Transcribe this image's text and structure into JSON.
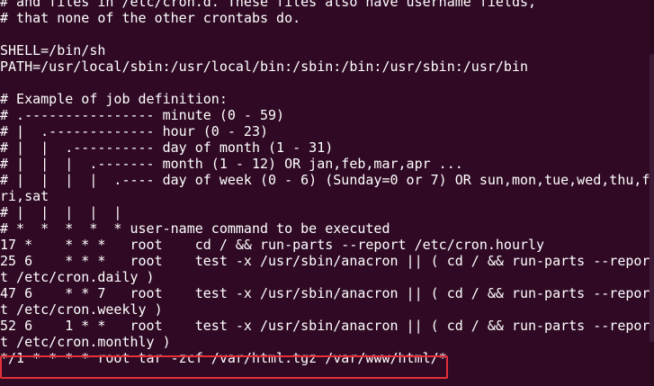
{
  "terminal": {
    "lines": [
      "# and files in /etc/cron.d. These files also have username fields,",
      "# that none of the other crontabs do.",
      "",
      "SHELL=/bin/sh",
      "PATH=/usr/local/sbin:/usr/local/bin:/sbin:/bin:/usr/sbin:/usr/bin",
      "",
      "# Example of job definition:",
      "# .---------------- minute (0 - 59)",
      "# |  .------------- hour (0 - 23)",
      "# |  |  .---------- day of month (1 - 31)",
      "# |  |  |  .------- month (1 - 12) OR jan,feb,mar,apr ...",
      "# |  |  |  |  .---- day of week (0 - 6) (Sunday=0 or 7) OR sun,mon,tue,wed,thu,f",
      "ri,sat",
      "# |  |  |  |  |",
      "# *  *  *  *  * user-name command to be executed",
      "17 *    * * *   root    cd / && run-parts --report /etc/cron.hourly",
      "25 6    * * *   root    test -x /usr/sbin/anacron || ( cd / && run-parts --repor",
      "t /etc/cron.daily )",
      "47 6    * * 7   root    test -x /usr/sbin/anacron || ( cd / && run-parts --repor",
      "t /etc/cron.weekly )",
      "52 6    1 * *   root    test -x /usr/sbin/anacron || ( cd / && run-parts --repor",
      "t /etc/cron.monthly )",
      "*/1 * * * * root tar -zcf /var/html.tgz /var/www/html/*"
    ],
    "colors": {
      "background": "#300a24",
      "text": "#ffffff",
      "highlight_border": "#e3303a"
    }
  }
}
